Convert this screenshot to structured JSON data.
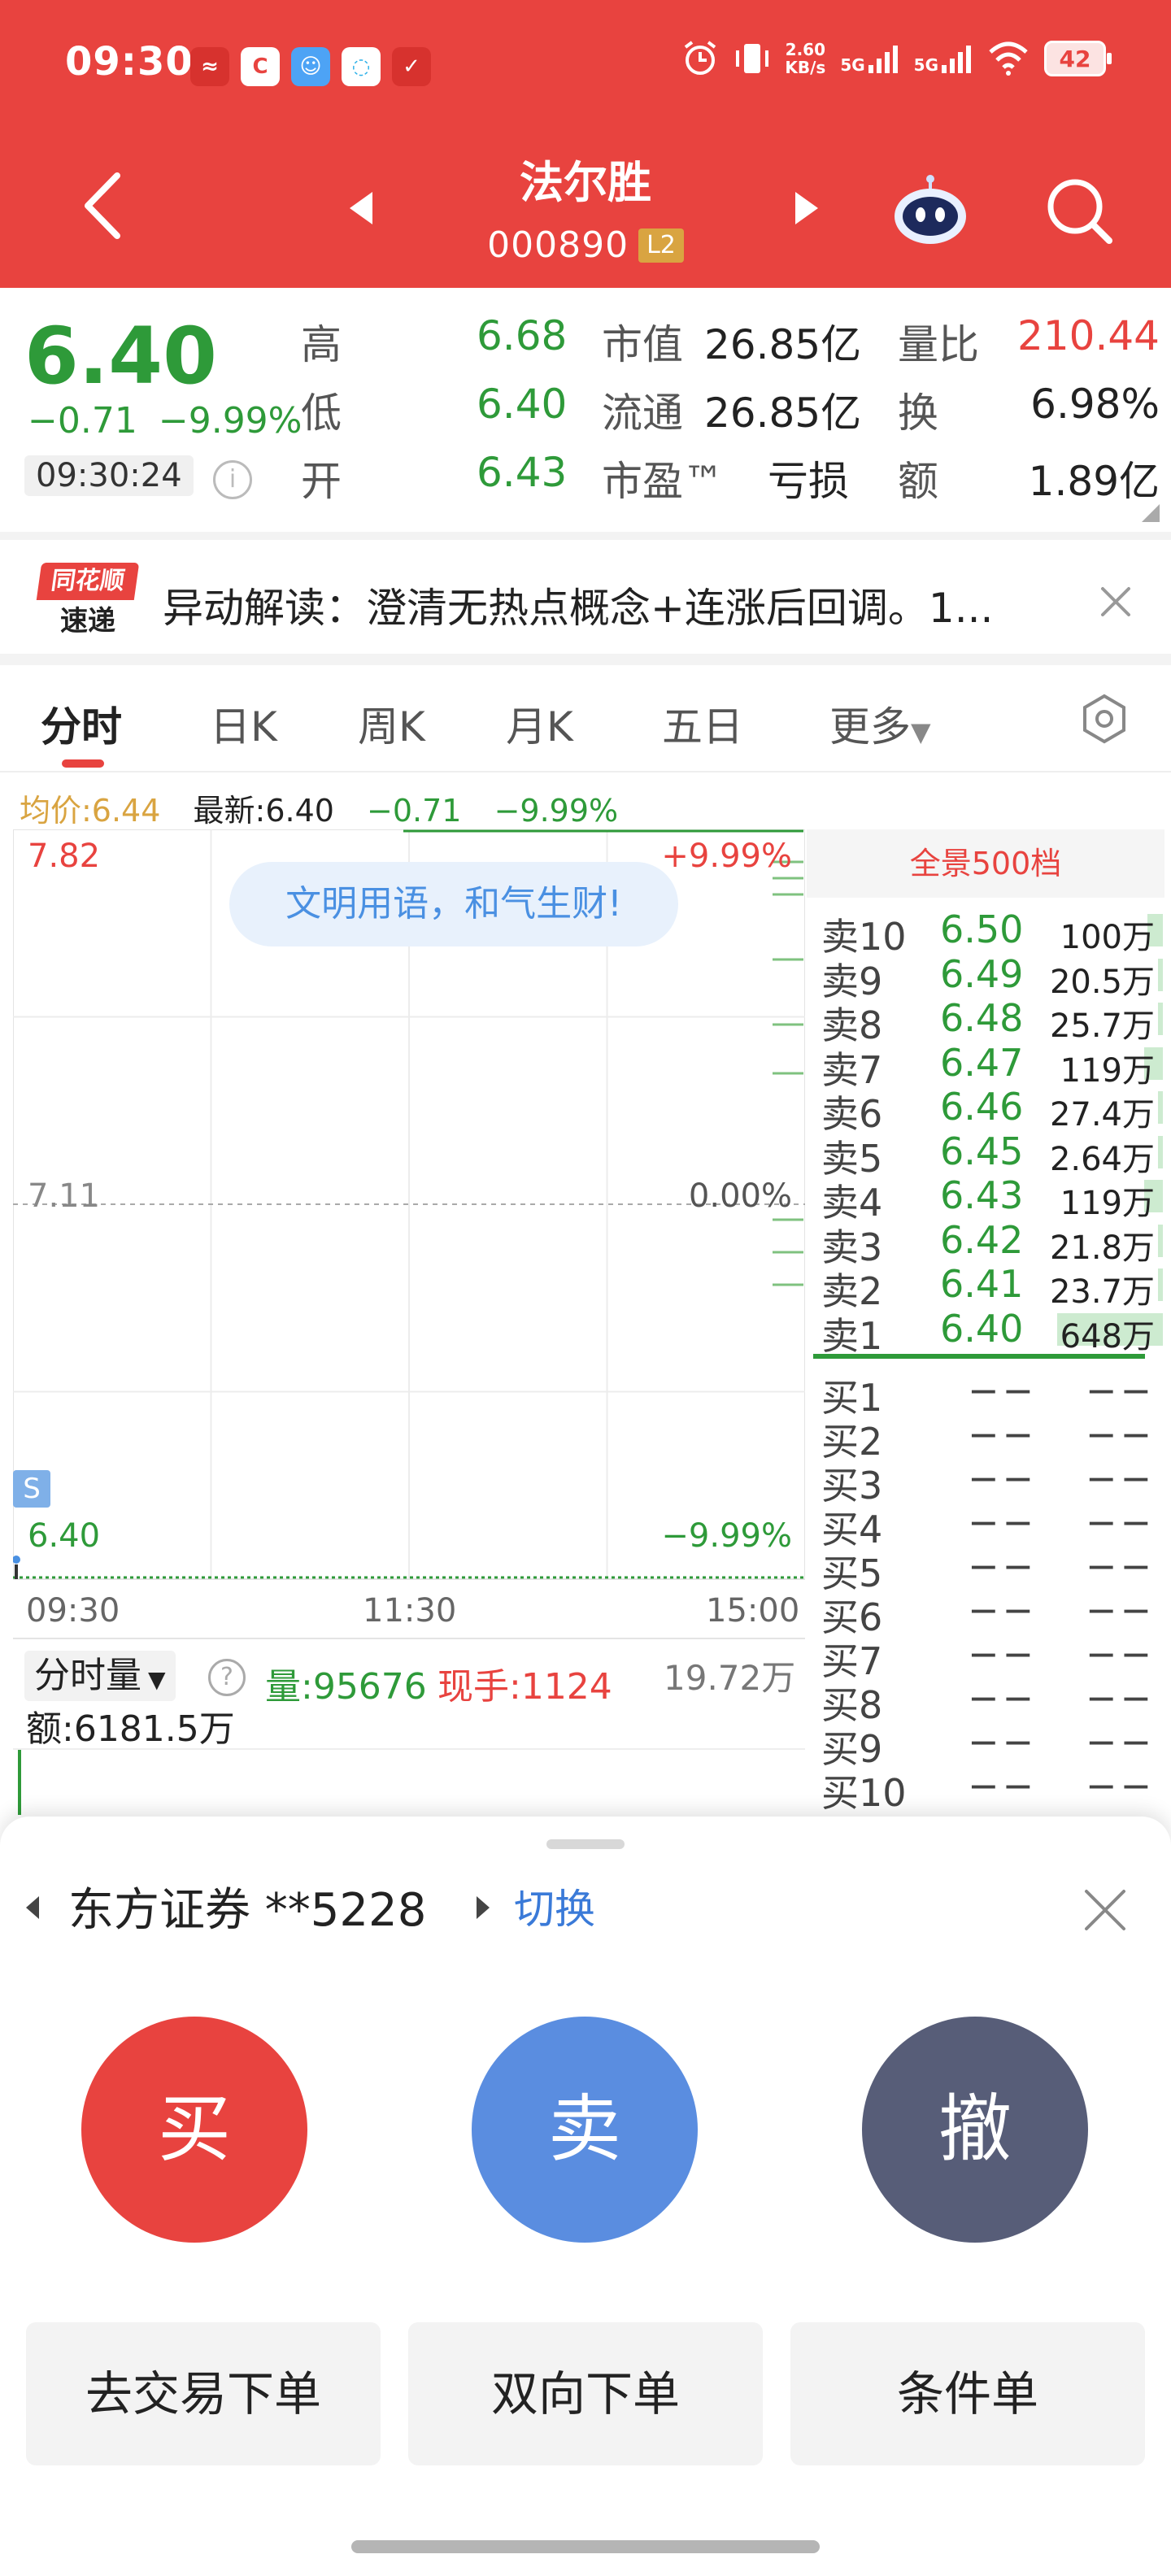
{
  "status_bar": {
    "time": "09:30",
    "net_speed_value": "2.60",
    "net_speed_unit": "KB/s",
    "signal1": "5G",
    "signal2": "5G",
    "battery": "42"
  },
  "header": {
    "stock_name": "法尔胜",
    "stock_code": "000890",
    "level_badge": "L2"
  },
  "quote": {
    "price": "6.40",
    "change": "−0.71",
    "change_pct": "−9.99%",
    "time": "09:30:24",
    "info_icon": "i",
    "high_label": "高",
    "high_value": "6.68",
    "low_label": "低",
    "low_value": "6.40",
    "open_label": "开",
    "open_value": "6.43",
    "mcap_label": "市值",
    "mcap_value": "26.85亿",
    "float_label": "流通",
    "float_value": "26.85亿",
    "pe_label": "市盈™",
    "pe_value": "亏损",
    "vol_ratio_label": "量比",
    "vol_ratio_value": "210.44",
    "turnover_label": "换",
    "turnover_value": "6.98%",
    "amount_label": "额",
    "amount_value": "1.89亿"
  },
  "news": {
    "logo_line1": "同花顺",
    "logo_line2": "速递",
    "text": "异动解读：澄清无热点概念+连涨后回调。1..."
  },
  "tabs": [
    {
      "label": "分时"
    },
    {
      "label": "日K"
    },
    {
      "label": "周K"
    },
    {
      "label": "月K"
    },
    {
      "label": "五日"
    },
    {
      "label": "更多"
    }
  ],
  "chart": {
    "avg_label": "均价:6.44",
    "latest_label": "最新:6.40",
    "latest_change": "−0.71",
    "latest_pct": "−9.99%",
    "bubble_text": "文明用语，和气生财!",
    "marker": "S",
    "time_start": "09:30",
    "time_mid": "11:30",
    "time_end": "15:00"
  },
  "chart_data": {
    "type": "line",
    "y_labels_left": [
      "7.82",
      "7.11",
      "6.40"
    ],
    "y_labels_right": [
      "+9.99%",
      "0.00%",
      "−9.99%"
    ],
    "x_ticks": [
      "09:30",
      "11:30",
      "15:00"
    ],
    "ylim": [
      6.4,
      7.82
    ],
    "prev_close": 7.11,
    "series": [
      {
        "values": [
          6.4
        ]
      }
    ]
  },
  "volume": {
    "selector": "分时量",
    "help_icon": "?",
    "qty": "量:95676",
    "hand": "现手:1124",
    "max": "19.72万",
    "amount": "额:6181.5万"
  },
  "orderbook": {
    "title": "全景500档",
    "asks": [
      {
        "label": "卖10",
        "price": "6.50",
        "vol": "100万",
        "bar": 0.15
      },
      {
        "label": "卖9",
        "price": "6.49",
        "vol": "20.5万",
        "bar": 0.03
      },
      {
        "label": "卖8",
        "price": "6.48",
        "vol": "25.7万",
        "bar": 0.04
      },
      {
        "label": "卖7",
        "price": "6.47",
        "vol": "119万",
        "bar": 0.18
      },
      {
        "label": "卖6",
        "price": "6.46",
        "vol": "27.4万",
        "bar": 0.04
      },
      {
        "label": "卖5",
        "price": "6.45",
        "vol": "2.64万",
        "bar": 0.0
      },
      {
        "label": "卖4",
        "price": "6.43",
        "vol": "119万",
        "bar": 0.18
      },
      {
        "label": "卖3",
        "price": "6.42",
        "vol": "21.8万",
        "bar": 0.03
      },
      {
        "label": "卖2",
        "price": "6.41",
        "vol": "23.7万",
        "bar": 0.04
      },
      {
        "label": "卖1",
        "price": "6.40",
        "vol": "648万",
        "bar": 1.0
      }
    ],
    "bids": [
      {
        "label": "买1",
        "price": "−−",
        "vol": "−−"
      },
      {
        "label": "买2",
        "price": "−−",
        "vol": "−−"
      },
      {
        "label": "买3",
        "price": "−−",
        "vol": "−−"
      },
      {
        "label": "买4",
        "price": "−−",
        "vol": "−−"
      },
      {
        "label": "买5",
        "price": "−−",
        "vol": "−−"
      },
      {
        "label": "买6",
        "price": "−−",
        "vol": "−−"
      },
      {
        "label": "买7",
        "price": "−−",
        "vol": "−−"
      },
      {
        "label": "买8",
        "price": "−−",
        "vol": "−−"
      },
      {
        "label": "买9",
        "price": "−−",
        "vol": "−−"
      },
      {
        "label": "买10",
        "price": "−−",
        "vol": "−−"
      }
    ]
  },
  "sheet": {
    "account": "东方证券 **5228",
    "switch_label": "切换",
    "buy_label": "买",
    "sell_label": "卖",
    "cancel_label": "撤",
    "trade_order_label": "去交易下单",
    "two_way_label": "双向下单",
    "conditional_label": "条件单"
  },
  "colors": {
    "brand_red": "#e8433f",
    "down_green": "#2e9a39",
    "sell_blue": "#5a8de0",
    "cancel_slate": "#575d78",
    "link_blue": "#3a7ad8"
  }
}
